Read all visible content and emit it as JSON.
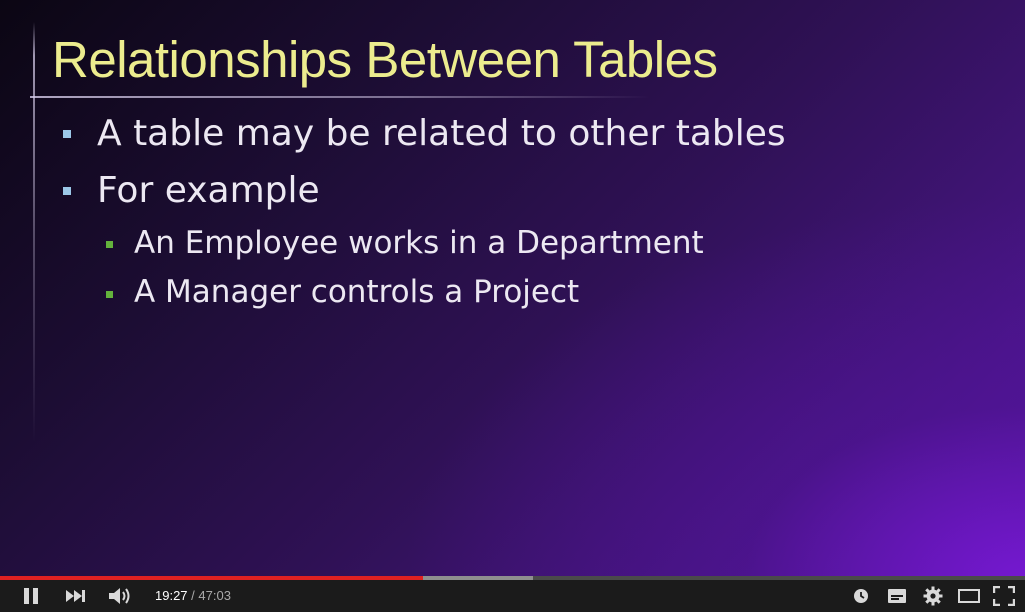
{
  "slide": {
    "title": "Relationships Between Tables",
    "bullets": [
      {
        "text": "A table may be related to other tables",
        "level": 1
      },
      {
        "text": "For example",
        "level": 1
      },
      {
        "text": "An Employee works in a Department",
        "level": 2
      },
      {
        "text": "A Manager controls a Project",
        "level": 2
      }
    ],
    "colors": {
      "title": "#ecec8e",
      "text": "#ece8f2",
      "level1_marker": "#9cc8e8",
      "level2_marker": "#63b23c"
    }
  },
  "player": {
    "current_time": "19:27",
    "separator": "/",
    "duration": "47:03",
    "played_fraction": 0.413,
    "buffered_fraction": 0.52,
    "colors": {
      "played": "#e02121",
      "buffered": "#8f8f8f",
      "track": "#4a4a4a",
      "bar": "#1b1b1b"
    },
    "controls": [
      "pause-icon",
      "next-icon",
      "volume-icon",
      "watch-later-icon",
      "captions-icon",
      "settings-icon",
      "theater-mode-icon",
      "fullscreen-icon"
    ]
  }
}
